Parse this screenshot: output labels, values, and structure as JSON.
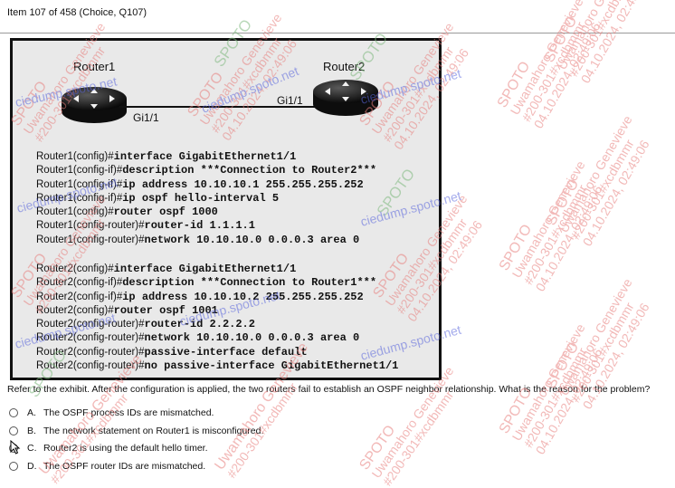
{
  "header": {
    "title": "Item 107 of 458  (Choice, Q107)"
  },
  "exhibit": {
    "router1": {
      "label": "Router1",
      "interface": "Gi1/1"
    },
    "router2": {
      "label": "Router2",
      "interface": "Gi1/1"
    },
    "router1_config": [
      {
        "prompt": "Router1(config)#",
        "cmd": "interface GigabitEthernet1/1"
      },
      {
        "prompt": "Router1(config-if)#",
        "cmd": "description ***Connection to Router2***"
      },
      {
        "prompt": "Router1(config-if)#",
        "cmd": "ip address 10.10.10.1 255.255.255.252"
      },
      {
        "prompt": "Router1(config-if)#",
        "cmd": "ip ospf hello-interval 5"
      },
      {
        "prompt": "Router1(config)#",
        "cmd": "router ospf 1000"
      },
      {
        "prompt": "Router1(config-router)#",
        "cmd": "router-id 1.1.1.1"
      },
      {
        "prompt": "Router1(config-router)#",
        "cmd": "network 10.10.10.0 0.0.0.3 area 0"
      }
    ],
    "router2_config": [
      {
        "prompt": "Router2(config)#",
        "cmd": "interface GigabitEthernet1/1"
      },
      {
        "prompt": "Router2(config-if)#",
        "cmd": "description ***Connection to Router1***"
      },
      {
        "prompt": "Router2(config-if)#",
        "cmd": "ip address 10.10.10.2 255.255.255.252"
      },
      {
        "prompt": "Router2(config)#",
        "cmd": "router ospf 1001"
      },
      {
        "prompt": "Router2(config-router)#",
        "cmd": "router-id 2.2.2.2"
      },
      {
        "prompt": "Router2(config-router)#",
        "cmd": "network 10.10.10.0 0.0.0.3 area 0"
      },
      {
        "prompt": "Router2(config-router)#",
        "cmd": "passive-interface default"
      },
      {
        "prompt": "Router2(config-router)#",
        "cmd": "no passive-interface GigabitEthernet1/1"
      }
    ]
  },
  "question": {
    "text": "Refer to the exhibit. After the configuration is applied, the two routers fail to establish an OSPF neighbor relationship. What is the reason for the problem?"
  },
  "options": [
    {
      "letter": "A.",
      "text": "The OSPF process IDs are mismatched."
    },
    {
      "letter": "B.",
      "text": "The network statement on Router1 is misconfigured."
    },
    {
      "letter": "C.",
      "text": "Router2 is using the default hello timer."
    },
    {
      "letter": "D.",
      "text": "The OSPF router IDs are mismatched."
    }
  ],
  "watermarks": [
    "SPOTO",
    "ciedump.spoto.net",
    "Uwamahoro Genevieve",
    "#200-301#xcdbmmr",
    "04.10.2024, 02:49:06"
  ],
  "colors": {
    "watermark_red": "#e8807e",
    "watermark_blue": "#5a66dd",
    "watermark_green": "#7fb97f"
  }
}
